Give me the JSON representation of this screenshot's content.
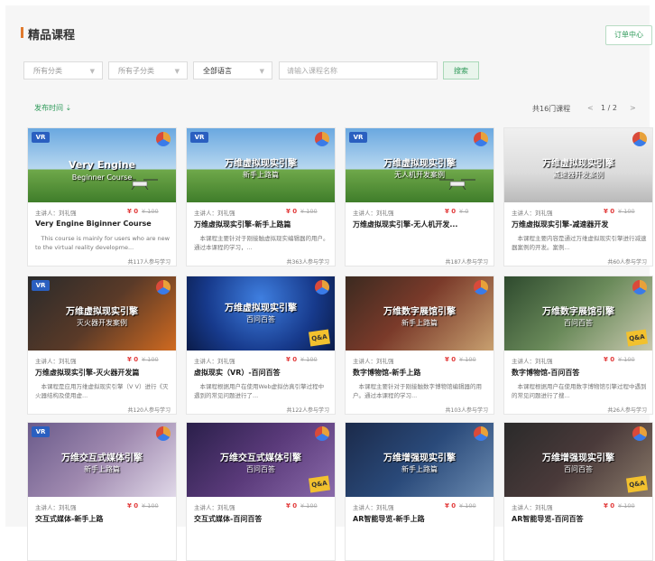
{
  "header": {
    "title": "精品课程",
    "order_button": "订单中心"
  },
  "filters": {
    "category": "所有分类",
    "subcategory": "所有子分类",
    "language": "全部语言",
    "search_placeholder": "请输入课程名称",
    "search_button": "搜索"
  },
  "listbar": {
    "sort_label": "发布时间 ⇣",
    "count": "共16门课程",
    "prev": "<",
    "page": "1 / 2",
    "next": ">"
  },
  "colors": {
    "accent": "#2f9a5a",
    "price": "#e23b3b",
    "header_bar": "#e07a2e"
  },
  "courses": [
    {
      "thumb_line1": "Very Engine",
      "thumb_line2": "Beginner Course",
      "teacher": "主讲人：刘礼强",
      "price": "¥ 0",
      "original_price": "¥ 100",
      "title": "Very Engine Biginner Course",
      "desc": "This course is mainly for users who are new to the virtual reality developme...",
      "learners": "共117人参与学习"
    },
    {
      "thumb_line1": "万维虚拟现实引擎",
      "thumb_line2": "新手上路篇",
      "teacher": "主讲人：刘礼强",
      "price": "¥ 0",
      "original_price": "¥ 100",
      "title": "万维虚拟现实引擎-新手上路篇",
      "desc": "本课程主要针对于刚接触虚拟现实编辑器的用户。通过本课程的学习，...",
      "learners": "共363人参与学习"
    },
    {
      "thumb_line1": "万维虚拟现实引擎",
      "thumb_line2": "无人机开发案例",
      "teacher": "主讲人：刘礼强",
      "price": "¥ 0",
      "original_price": "¥ 0",
      "title": "万维虚拟现实引擎-无人机开发...",
      "desc": "",
      "learners": "共187人参与学习"
    },
    {
      "thumb_line1": "万维虚拟现实引擎",
      "thumb_line2": "减速器开发案例",
      "teacher": "主讲人：刘礼强",
      "price": "¥ 0",
      "original_price": "¥ 100",
      "title": "万维虚拟现实引擎-减速器开发",
      "desc": "本课程主要内容是通过万维虚拟现实引擎进行减速器案例的开发。案例...",
      "learners": "共60人参与学习"
    },
    {
      "thumb_line1": "万维虚拟现实引擎",
      "thumb_line2": "灭火器开发案例",
      "teacher": "主讲人：刘礼强",
      "price": "¥ 0",
      "original_price": "¥ 100",
      "title": "万维虚拟现实引擎-灭火器开发篇",
      "desc": "本课程是应用万维虚拟现实引擎（V V）进行《灭火器结构及使用虚...",
      "learners": "共120人参与学习"
    },
    {
      "thumb_line1": "万维虚拟现实引擎",
      "thumb_line2": "百问百答",
      "teacher": "主讲人：刘礼强",
      "price": "¥ 0",
      "original_price": "¥ 100",
      "title": "虚拟现实（VR）-百问百答",
      "desc": "本课程根据用户在使用Web虚拟仿真引擎过程中遇到的常见问题进行了...",
      "learners": "共122人参与学习"
    },
    {
      "thumb_line1": "万维数字展馆引擎",
      "thumb_line2": "新手上路篇",
      "teacher": "主讲人：刘礼强",
      "price": "¥ 0",
      "original_price": "¥ 100",
      "title": "数字博物馆-新手上路",
      "desc": "本课程主要针对于刚接触数字博物馆编辑器的用户。通过本课程的学习...",
      "learners": "共103人参与学习"
    },
    {
      "thumb_line1": "万维数字展馆引擎",
      "thumb_line2": "百问百答",
      "teacher": "主讲人：刘礼强",
      "price": "¥ 0",
      "original_price": "¥ 100",
      "title": "数字博物馆-百问百答",
      "desc": "本课程根据用户在使用数字博物馆引擎过程中遇到的常见问题进行了搜...",
      "learners": "共26人参与学习"
    },
    {
      "thumb_line1": "万维交互式媒体引擎",
      "thumb_line2": "新手上路篇",
      "teacher": "主讲人：刘礼强",
      "price": "¥ 0",
      "original_price": "¥ 100",
      "title": "交互式媒体-新手上路",
      "desc": "",
      "learners": ""
    },
    {
      "thumb_line1": "万维交互式媒体引擎",
      "thumb_line2": "百问百答",
      "teacher": "主讲人：刘礼强",
      "price": "¥ 0",
      "original_price": "¥ 100",
      "title": "交互式媒体-百问百答",
      "desc": "",
      "learners": ""
    },
    {
      "thumb_line1": "万维增强现实引擎",
      "thumb_line2": "新手上路篇",
      "teacher": "主讲人：刘礼强",
      "price": "¥ 0",
      "original_price": "¥ 100",
      "title": "AR智能导览-新手上路",
      "desc": "",
      "learners": ""
    },
    {
      "thumb_line1": "万维增强现实引擎",
      "thumb_line2": "百问百答",
      "teacher": "主讲人：刘礼强",
      "price": "¥ 0",
      "original_price": "¥ 100",
      "title": "AR智能导览-百问百答",
      "desc": "",
      "learners": ""
    }
  ]
}
